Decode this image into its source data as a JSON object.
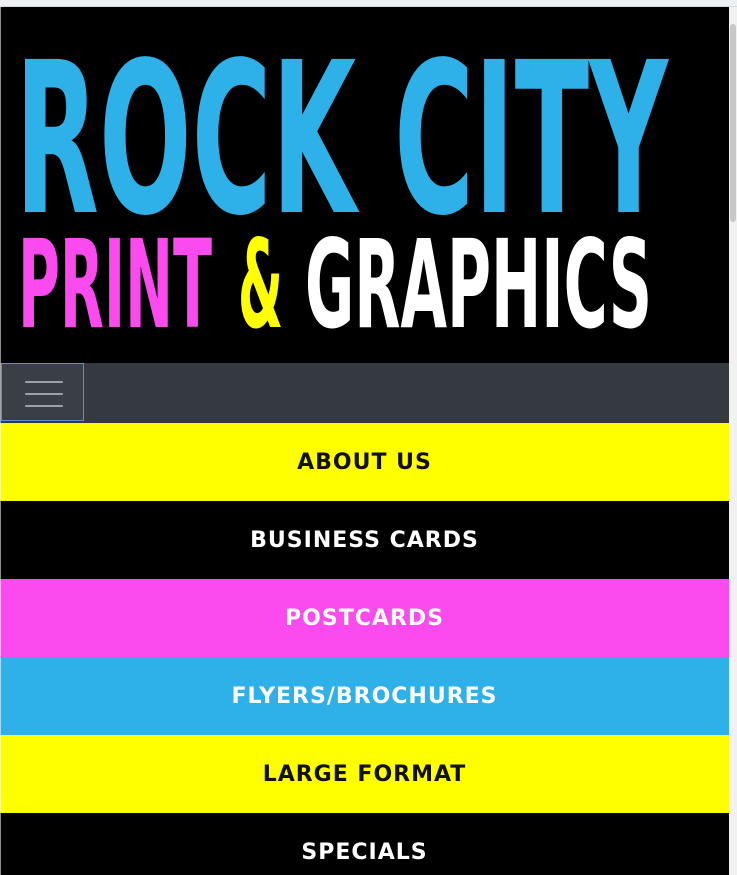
{
  "logo": {
    "line1": "ROCK CITY",
    "word_print": "PRINT",
    "word_amp": "&",
    "word_graphics": "GRAPHICS",
    "colors": {
      "blue": "#2eb1e8",
      "pink": "#fb4aee",
      "yellow": "#ffff00",
      "white": "#ffffff",
      "black": "#000000"
    }
  },
  "navbar": {
    "toggle_icon": "hamburger-menu-icon",
    "background": "#343a40"
  },
  "menu": {
    "items": [
      {
        "label": "ABOUT US",
        "background": "#ffff00",
        "text_color": "#111111"
      },
      {
        "label": "BUSINESS CARDS",
        "background": "#000000",
        "text_color": "#ffffff"
      },
      {
        "label": "POSTCARDS",
        "background": "#fb4aee",
        "text_color": "#ffffff"
      },
      {
        "label": "FLYERS/BROCHURES",
        "background": "#2eb1e8",
        "text_color": "#ffffff"
      },
      {
        "label": "LARGE FORMAT",
        "background": "#ffff00",
        "text_color": "#111111"
      },
      {
        "label": "SPECIALS",
        "background": "#000000",
        "text_color": "#ffffff"
      }
    ]
  }
}
